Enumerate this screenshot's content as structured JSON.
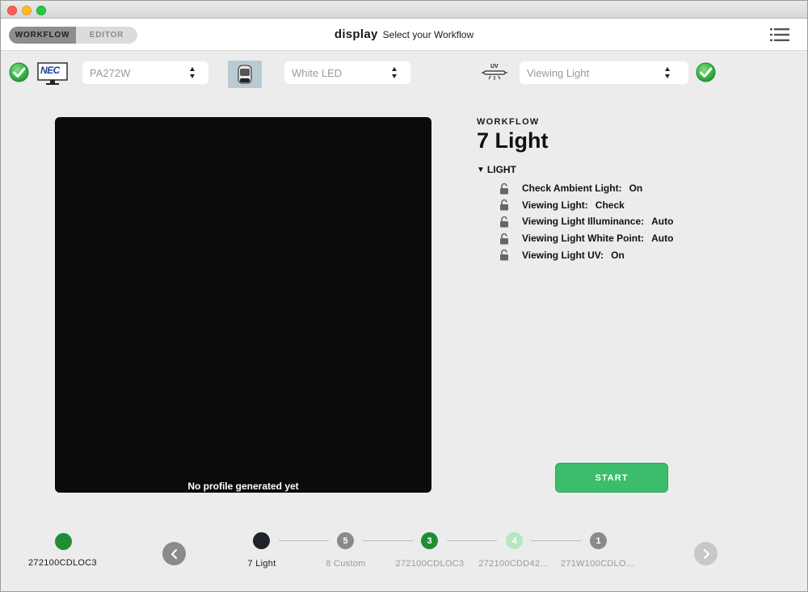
{
  "header": {
    "segments": [
      {
        "label": "WORKFLOW",
        "active": true
      },
      {
        "label": "EDITOR",
        "active": false
      }
    ],
    "title": "display",
    "subtitle": "Select your Workflow",
    "menu_icon": "list-icon"
  },
  "devices": {
    "monitor_status_icon": "check-circle-icon",
    "monitor_brand": "NEC",
    "monitor_model": "PA272W",
    "sensor_icon": "colorimeter-icon",
    "backlight": "White LED",
    "uv_icon": "uv-light-icon",
    "uv_badge": "UV",
    "viewing_light_placeholder": "Viewing Light",
    "light_status_icon": "check-circle-icon"
  },
  "preview": {
    "caption": "No profile generated yet"
  },
  "workflow": {
    "label": "WORKFLOW",
    "name": "7 Light",
    "section": "LIGHT",
    "items": [
      {
        "name": "Check Ambient Light:",
        "value": "On"
      },
      {
        "name": "Viewing Light:",
        "value": "Check"
      },
      {
        "name": "Viewing Light Illuminance:",
        "value": "Auto"
      },
      {
        "name": "Viewing Light White Point:",
        "value": "Auto"
      },
      {
        "name": "Viewing Light UV:",
        "value": "On"
      }
    ]
  },
  "start_label": "START",
  "current_profile": {
    "label": "272100CDLOC3",
    "color": "#1e8e35"
  },
  "steps": [
    {
      "number": "",
      "label": "7 Light",
      "color": "#1f2329",
      "active": true
    },
    {
      "number": "5",
      "label": "8 Custom",
      "color": "#8a8a8a",
      "active": false
    },
    {
      "number": "3",
      "label": "272100CDLOC3",
      "color": "#1e8e35",
      "active": false
    },
    {
      "number": "4",
      "label": "272100CDD42…",
      "color": "#b6e6c4",
      "active": false
    },
    {
      "number": "1",
      "label": "271W100CDLO…",
      "color": "#8a8a8a",
      "active": false
    }
  ],
  "colors": {
    "accent_green": "#3cbd6c",
    "check_green": "#2ea84a"
  }
}
